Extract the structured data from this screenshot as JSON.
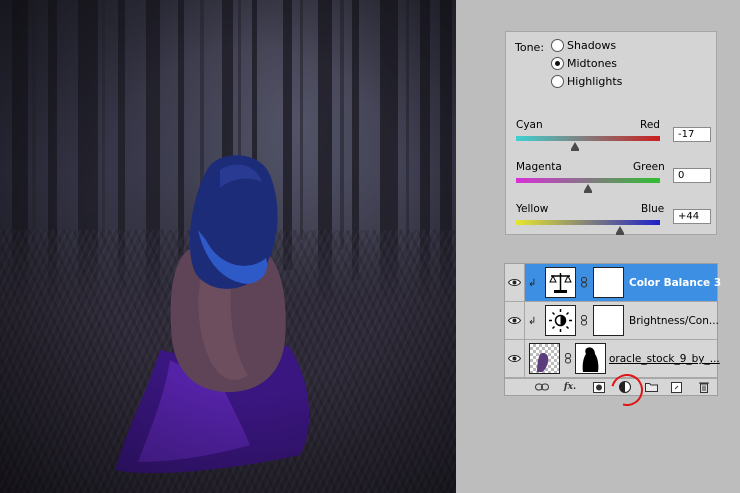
{
  "color_balance": {
    "tone_label": "Tone:",
    "tones": [
      {
        "label": "Shadows",
        "checked": false
      },
      {
        "label": "Midtones",
        "checked": true
      },
      {
        "label": "Highlights",
        "checked": false
      }
    ],
    "sliders": [
      {
        "left_label": "Cyan",
        "right_label": "Red",
        "value": "-17",
        "fraction": 0.41,
        "colors": [
          "#3fd1d1",
          "#cc1f1f"
        ]
      },
      {
        "left_label": "Magenta",
        "right_label": "Green",
        "value": "0",
        "fraction": 0.5,
        "colors": [
          "#d82fd8",
          "#2fbf2f"
        ]
      },
      {
        "left_label": "Yellow",
        "right_label": "Blue",
        "value": "+44",
        "fraction": 0.72,
        "colors": [
          "#e6e62e",
          "#1f1fc8"
        ]
      }
    ]
  },
  "layers": [
    {
      "name": "Color Balance 3",
      "selected": true,
      "clipped": true,
      "thumb_icon": "balance-scale-icon"
    },
    {
      "name": "Brightness/Con...",
      "selected": false,
      "clipped": true,
      "thumb_icon": "sun-icon"
    },
    {
      "name": "oracle_stock_9_by_...",
      "selected": false,
      "clipped": false,
      "thumb_icon": "checker-thumbnail"
    }
  ],
  "toolbar_icons": [
    "link-icon",
    "fx-icon",
    "add-mask-icon",
    "adjustment-layer-icon",
    "folder-icon",
    "new-layer-icon",
    "trash-icon"
  ],
  "colors": {
    "selection": "#3d8fe3",
    "annotation_circle": "#e01515",
    "panel_bg": "#d4d4d4"
  }
}
